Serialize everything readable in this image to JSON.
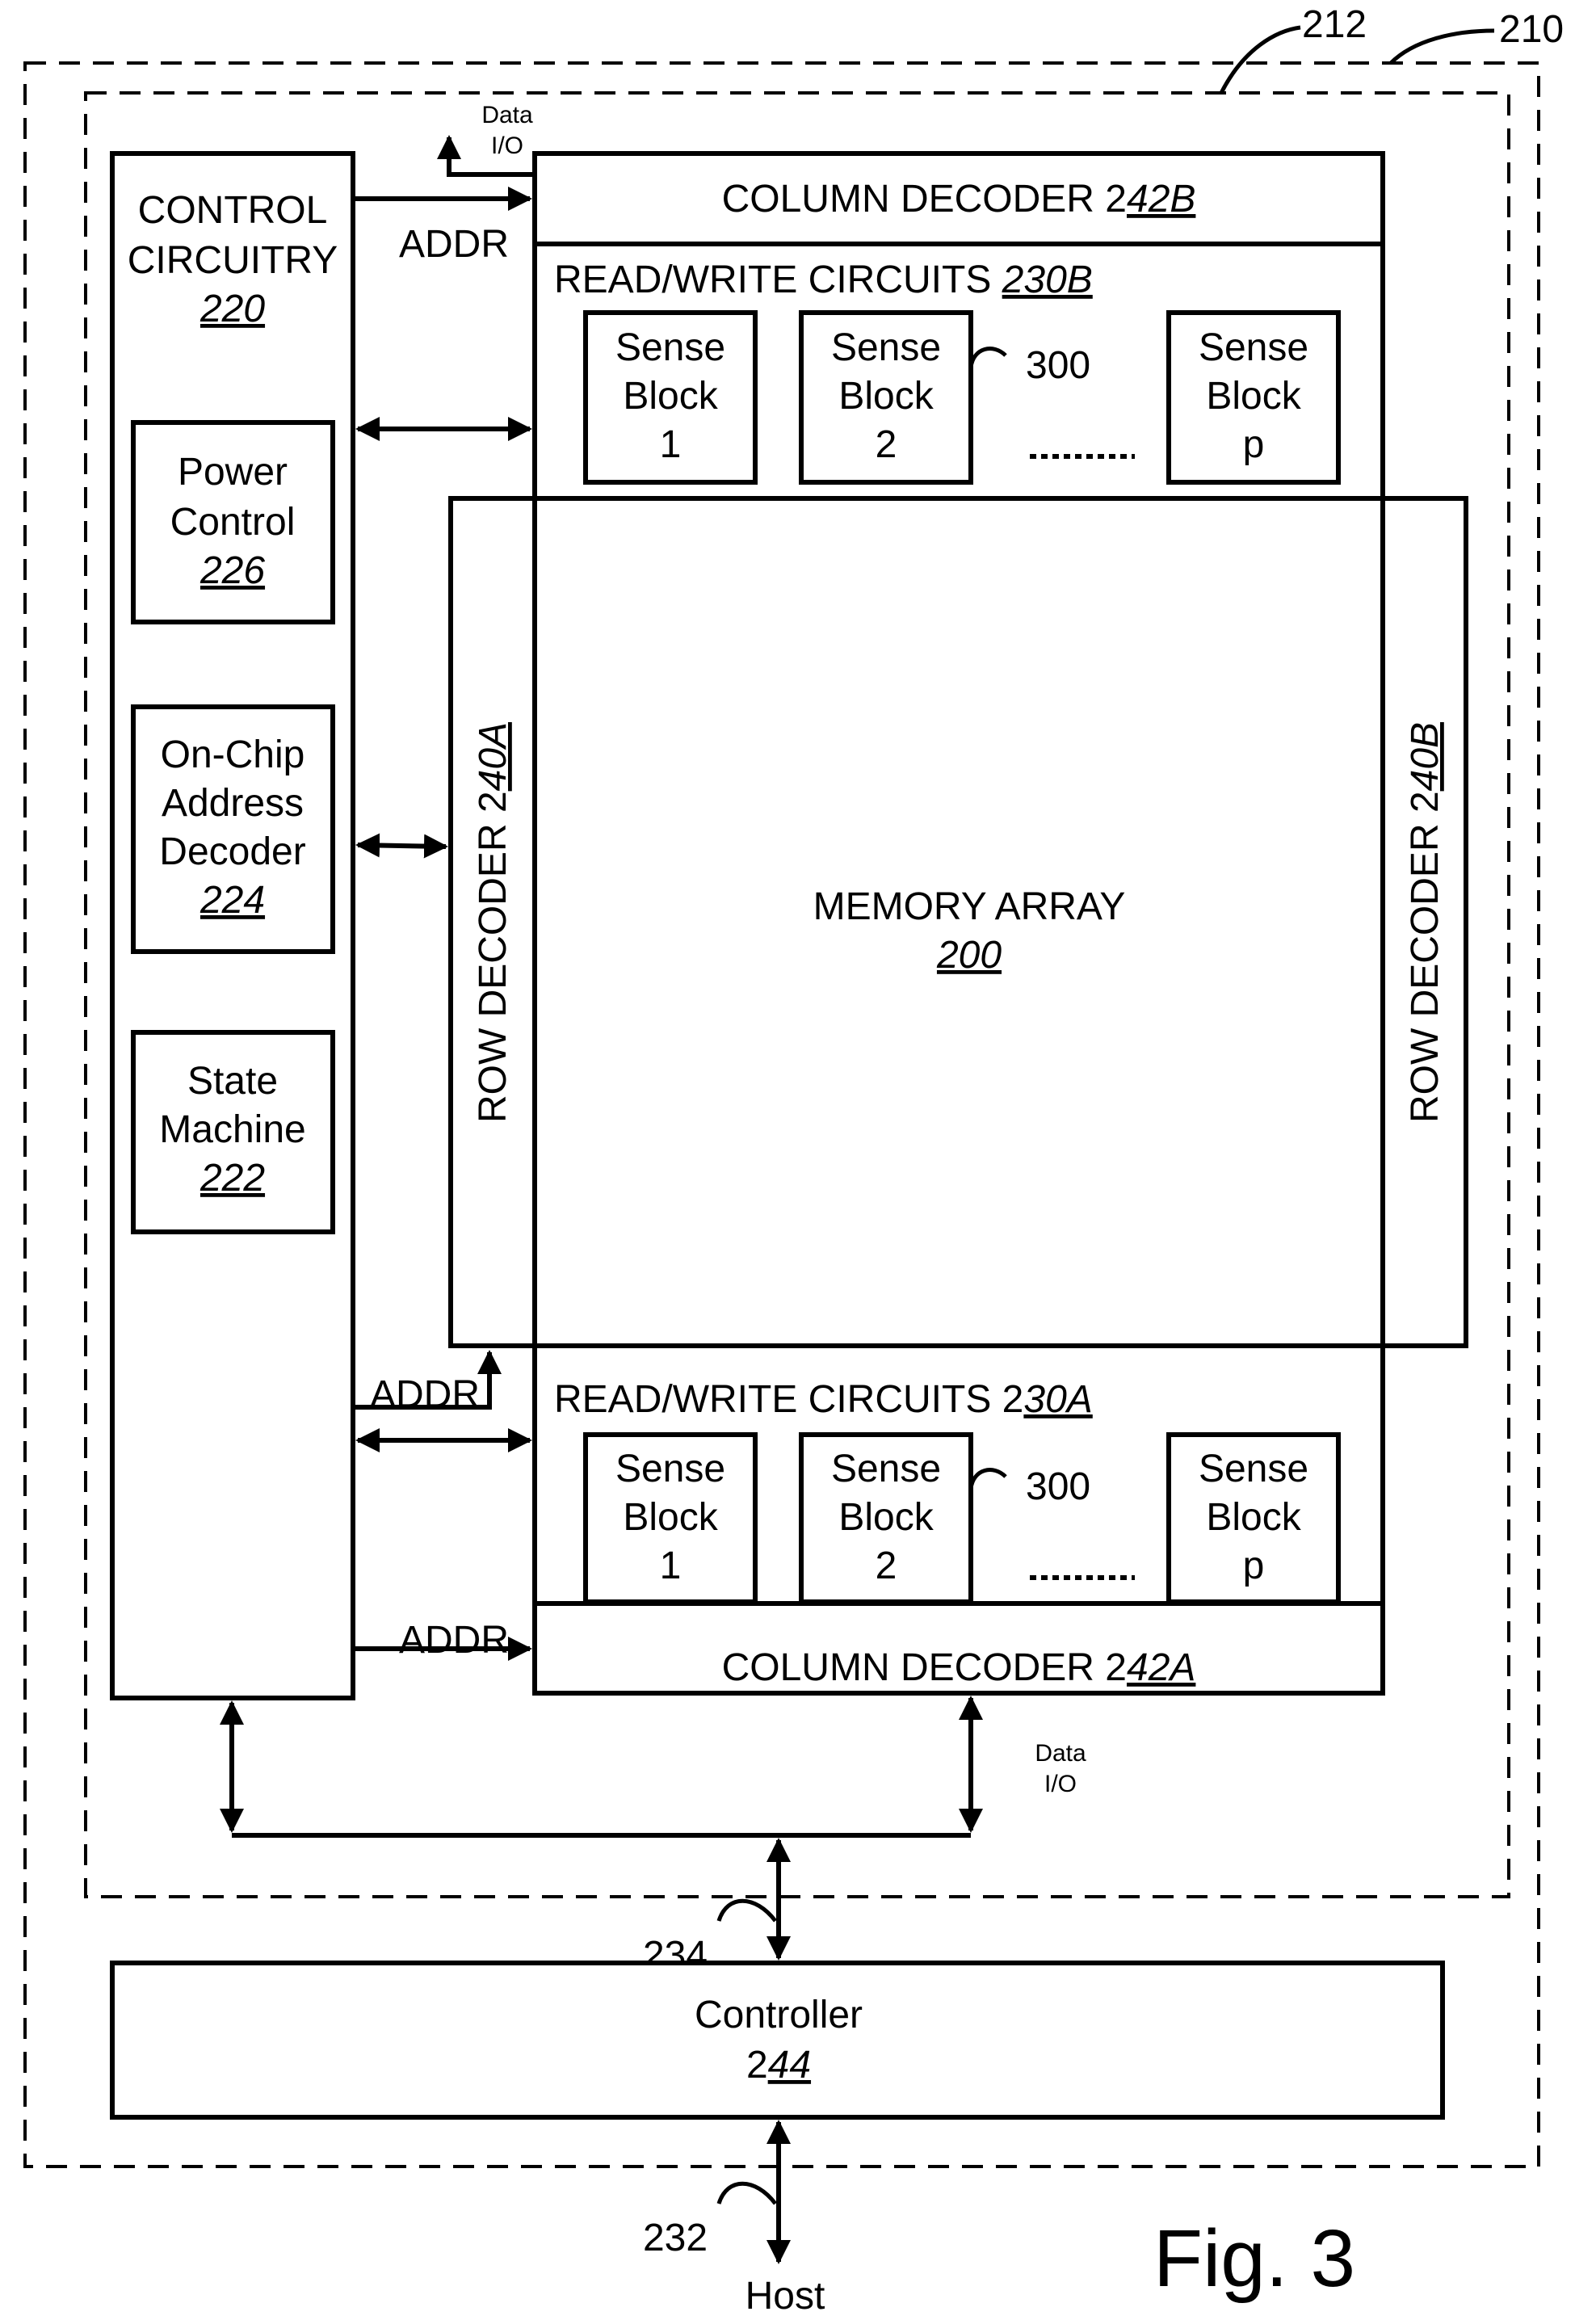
{
  "figure": {
    "caption": "Fig. 3",
    "refs": {
      "outer_boundary": "210",
      "inner_boundary": "212",
      "host_bus": "232",
      "controller_bus": "234",
      "sense_block_ref": "300"
    }
  },
  "control_circuitry": {
    "line1": "CONTROL",
    "line2": "CIRCUITRY",
    "ref": "220",
    "submodules": [
      {
        "line1": "Power",
        "line2": "Control",
        "ref": "226"
      },
      {
        "line1": "On-Chip",
        "line2": "Address",
        "line3": "Decoder",
        "ref": "224"
      },
      {
        "line1": "State",
        "line2": "Machine",
        "ref": "222"
      }
    ]
  },
  "column_decoder_top": {
    "text": "COLUMN DECODER 2",
    "ref": "42B"
  },
  "column_decoder_bottom": {
    "text": "COLUMN DECODER 2",
    "ref": "42A"
  },
  "rw_top": {
    "text": "READ/WRITE CIRCUITS ",
    "ref": "230B"
  },
  "rw_bottom": {
    "text": "READ/WRITE CIRCUITS 2",
    "ref": "30A"
  },
  "row_decoder_left": {
    "text": "ROW DECODER 2",
    "ref": "40A"
  },
  "row_decoder_right": {
    "text": "ROW DECODER 2",
    "ref": "40B"
  },
  "memory_array": {
    "text": "MEMORY ARRAY",
    "ref": "200"
  },
  "sense_blocks": [
    {
      "line1": "Sense",
      "line2": "Block",
      "line3": "1"
    },
    {
      "line1": "Sense",
      "line2": "Block",
      "line3": "2"
    },
    {
      "line1": "Sense",
      "line2": "Block",
      "line3": "p"
    }
  ],
  "ellipsis": "---------",
  "signals": {
    "addr": "ADDR",
    "data": "Data",
    "io": "I/O"
  },
  "controller": {
    "text": "Controller",
    "ref_prefix": "2",
    "ref": "44"
  },
  "host": "Host"
}
